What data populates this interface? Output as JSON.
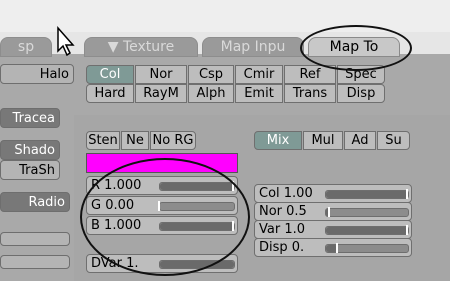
{
  "tabs": [
    {
      "label": "sp",
      "active": false
    },
    {
      "label": "▼ Texture",
      "active": false
    },
    {
      "label": "Map Inpu",
      "active": false
    },
    {
      "label": "Map To",
      "active": true
    }
  ],
  "left_column": {
    "items": [
      "Halo",
      "Tracea",
      "Shado",
      "TraSh",
      "Radio"
    ]
  },
  "map_to_row1": [
    "Col",
    "Nor",
    "Csp",
    "Cmir",
    "Ref",
    "Spec"
  ],
  "map_to_row2": [
    "Hard",
    "RayM",
    "Alph",
    "Emit",
    "Trans",
    "Disp"
  ],
  "stencil_row": [
    "Sten",
    "Ne",
    "No RG"
  ],
  "blend_modes": [
    "Mix",
    "Mul",
    "Ad",
    "Su"
  ],
  "color_swatch": "#ff00ff",
  "rgb_sliders": [
    {
      "label": "R 1.000",
      "fraction": 1.0
    },
    {
      "label": "G 0.00",
      "fraction": 0.0
    },
    {
      "label": "B 1.000",
      "fraction": 1.0
    }
  ],
  "dvar_slider": {
    "label": "DVar 1.",
    "fraction": 1.0
  },
  "right_sliders": [
    {
      "label": "Col 1.00",
      "fraction": 1.0
    },
    {
      "label": "Nor 0.5",
      "fraction": 0.05
    },
    {
      "label": "Var 1.0",
      "fraction": 1.0
    },
    {
      "label": "Disp 0.",
      "fraction": 0.15
    }
  ],
  "colors": {
    "selected_button": "#7f9a96",
    "panel_background": "#a9a9a9",
    "annotation_ellipse": "#111111"
  }
}
